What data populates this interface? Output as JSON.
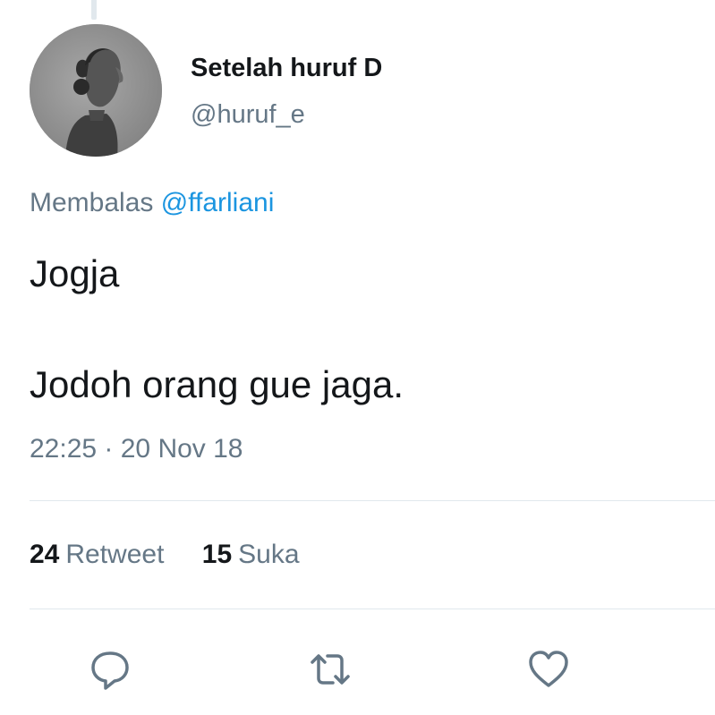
{
  "author": {
    "display_name": "Setelah huruf D",
    "handle": "@huruf_e"
  },
  "reply": {
    "prefix": "Membalas",
    "mention": "@ffarliani"
  },
  "tweet": {
    "line1": "Jogja",
    "line2": "Jodoh orang gue jaga."
  },
  "timestamp": "22:25 · 20 Nov 18",
  "stats": {
    "retweet_count": "24",
    "retweet_label": "Retweet",
    "like_count": "15",
    "like_label": "Suka"
  },
  "actions": {
    "icons": [
      "reply-icon",
      "retweet-icon",
      "heart-icon"
    ]
  },
  "colors": {
    "secondary_text": "#657786",
    "link": "#1b95e0",
    "divider": "#e1e8ed"
  }
}
